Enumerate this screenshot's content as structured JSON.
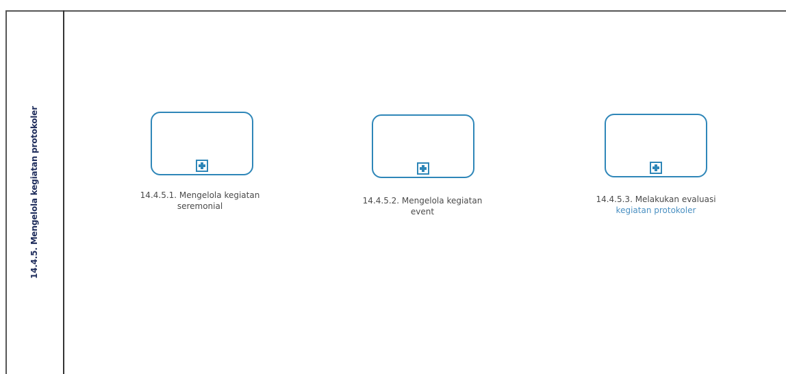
{
  "lane": {
    "title": "14.4.5. Mengelola kegiatan protokoler"
  },
  "tasks": [
    {
      "label_line1": "14.4.5.1. Mengelola kegiatan",
      "label_line2": "seremonial"
    },
    {
      "label_line1": "14.4.5.2. Mengelola kegiatan",
      "label_line2": "event"
    },
    {
      "label_line1": "14.4.5.3. Melakukan evaluasi",
      "label_line2": "kegiatan protokoler"
    }
  ],
  "colors": {
    "task_border": "#2e86b8",
    "lane_title": "#1f2d5c",
    "label_text": "#4a4a4a"
  }
}
